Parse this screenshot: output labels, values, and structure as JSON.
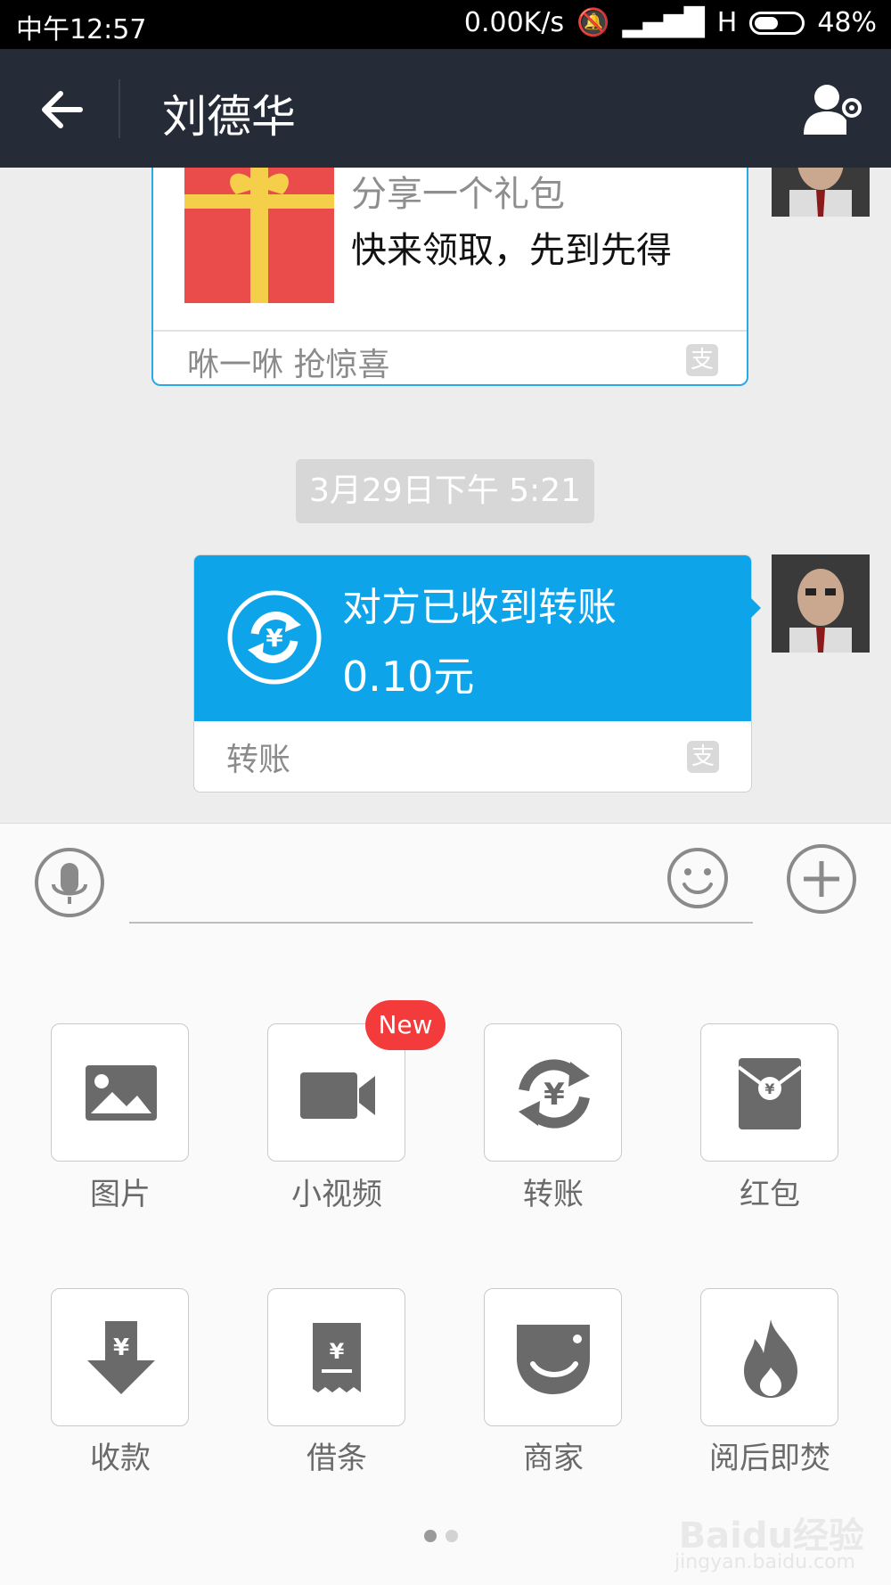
{
  "status_bar": {
    "time": "中午12:57",
    "network_speed": "0.00K/s",
    "network_type": "H",
    "battery_percent": "48%"
  },
  "header": {
    "title": "刘德华"
  },
  "messages": [
    {
      "type": "gift",
      "title": "分享一个礼包",
      "body": "快来领取，先到先得",
      "footer": "咻一咻 抢惊喜"
    },
    {
      "type": "timestamp",
      "text": "3月29日下午 5:21"
    },
    {
      "type": "transfer",
      "title": "对方已收到转账",
      "amount": "0.10元",
      "footer": "转账"
    }
  ],
  "input": {
    "value": "",
    "placeholder": ""
  },
  "panel": {
    "items": [
      {
        "label": "图片",
        "icon": "image-icon"
      },
      {
        "label": "小视频",
        "icon": "video-camera-icon",
        "badge": "New"
      },
      {
        "label": "转账",
        "icon": "transfer-icon"
      },
      {
        "label": "红包",
        "icon": "red-envelope-icon"
      },
      {
        "label": "收款",
        "icon": "receive-money-icon"
      },
      {
        "label": "借条",
        "icon": "iou-icon"
      },
      {
        "label": "商家",
        "icon": "merchant-icon"
      },
      {
        "label": "阅后即焚",
        "icon": "fire-icon"
      }
    ],
    "page_dots": 2,
    "active_page": 1
  },
  "watermark": {
    "brand": "Baidu经验",
    "url": "jingyan.baidu.com"
  },
  "colors": {
    "header_bg": "#262b38",
    "accent_blue": "#0ea4ea",
    "badge_red": "#f43b3b",
    "gift_red": "#ea4c4c",
    "ribbon_yellow": "#f6cf4a"
  }
}
